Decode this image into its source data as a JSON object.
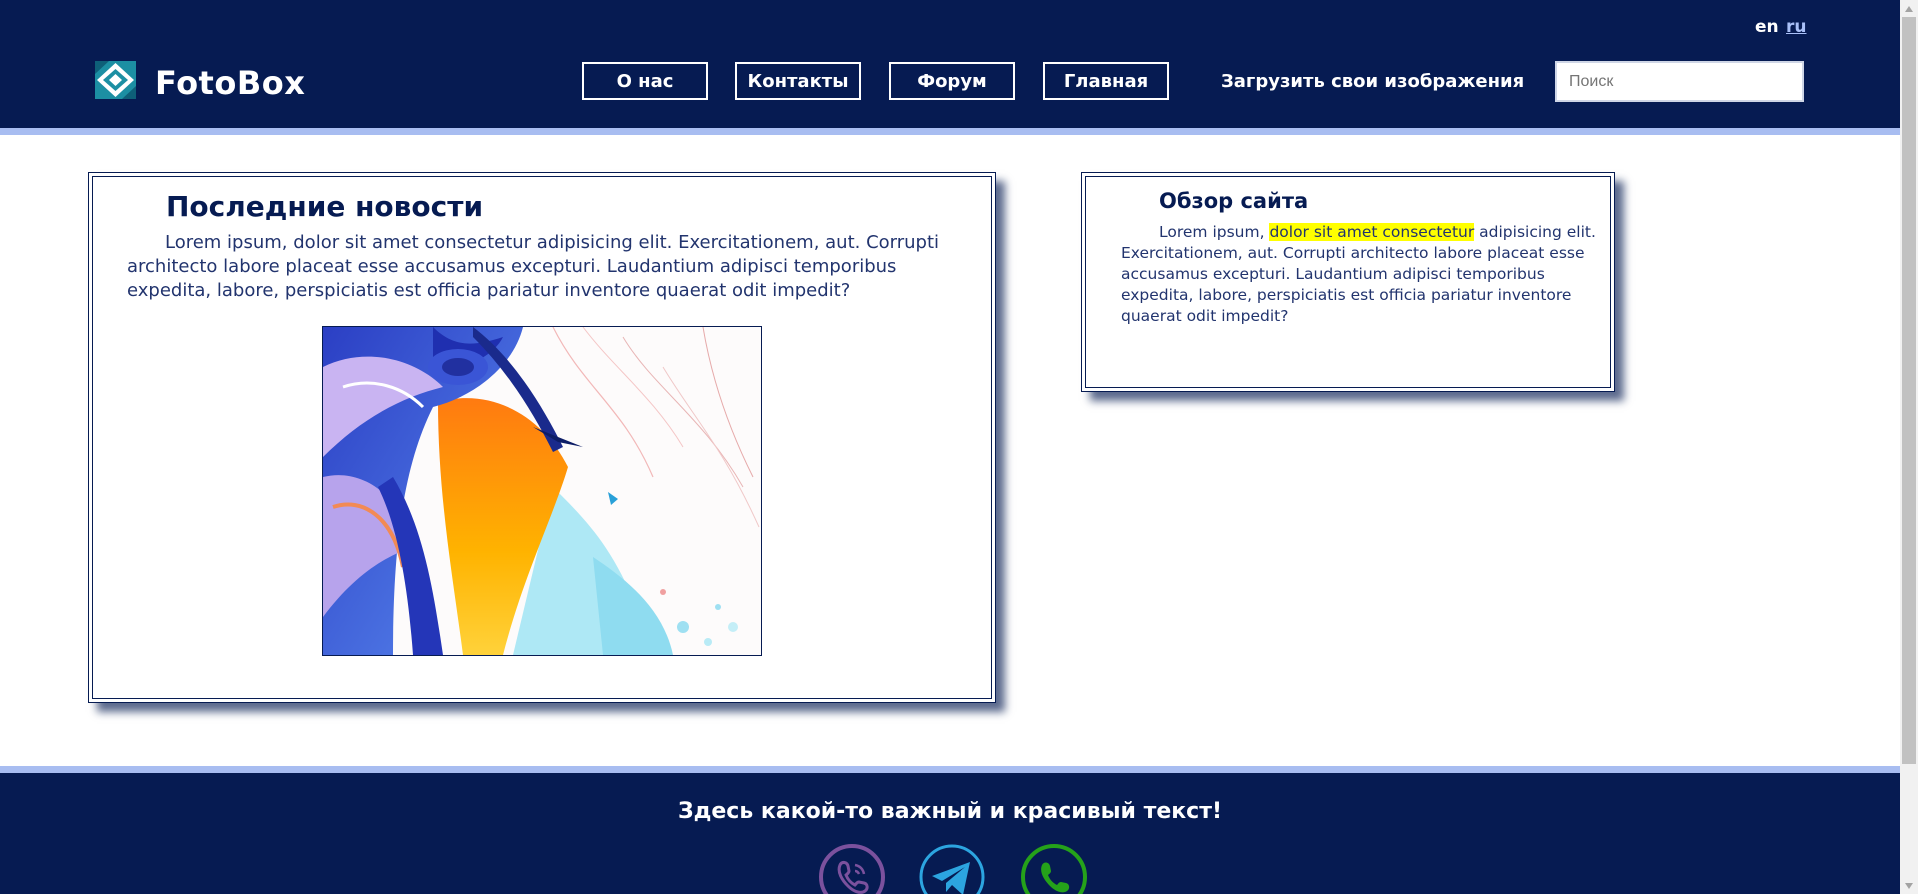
{
  "header": {
    "languages": [
      {
        "label": "en",
        "active": false
      },
      {
        "label": "ru",
        "active": true
      }
    ],
    "logo_text": "FotoBox",
    "logo_icon": "diamond-logo-icon",
    "nav": [
      {
        "label": "О нас"
      },
      {
        "label": "Контакты"
      },
      {
        "label": "Форум"
      },
      {
        "label": "Главная"
      }
    ],
    "upload_link": "Загрузить свои изображения",
    "search": {
      "placeholder": "Поиск",
      "value": ""
    }
  },
  "news": {
    "title": "Последние новости",
    "text": "Lorem ipsum, dolor sit amet consectetur adipisicing elit. Exercitationem, aut. Corrupti architecto labore placeat esse accusamus excepturi. Laudantium adipisci temporibus expedita, labore, perspiciatis est officia pariatur inventore quaerat odit impedit?"
  },
  "overview": {
    "title": "Обзор сайта",
    "text_before": "Lorem ipsum, ",
    "text_highlight": "dolor sit amet consectetur",
    "text_after": " adipisicing elit. Exercitationem, aut. Corrupti architecto labore placeat esse accusamus excepturi. Laudantium adipisci temporibus expedita, labore, perspiciatis est officia pariatur inventore quaerat odit impedit?"
  },
  "footer": {
    "text": "Здесь какой-то важный и красивый текст!",
    "social": [
      {
        "icon": "viber-icon",
        "color": "#7b519d"
      },
      {
        "icon": "telegram-icon",
        "color": "#2ca5e0"
      },
      {
        "icon": "whatsapp-icon",
        "color": "#25a21a"
      }
    ]
  },
  "colors": {
    "navy": "#061b52",
    "accent_strip": "#a8bdf1",
    "highlight": "#ffff00"
  }
}
